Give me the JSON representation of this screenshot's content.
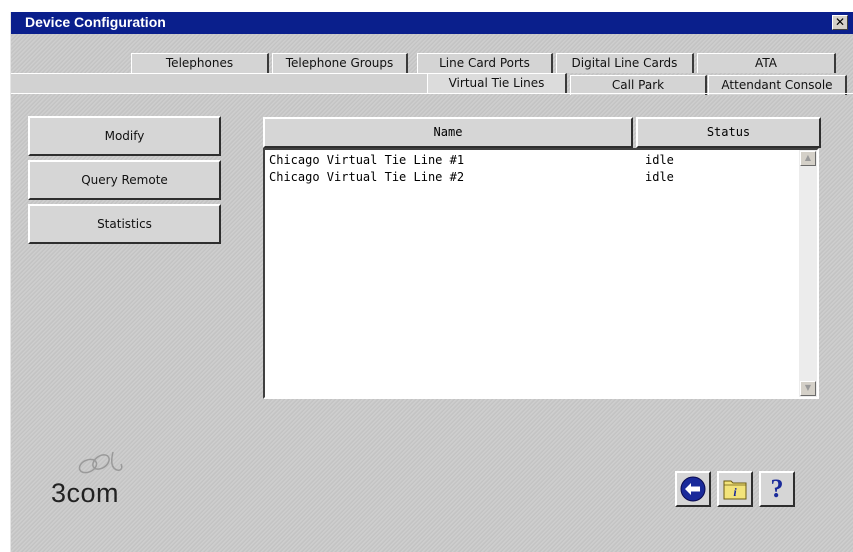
{
  "window": {
    "title": "Device Configuration",
    "close_glyph": "✕"
  },
  "tabs": {
    "row1": [
      {
        "label": "Telephones"
      },
      {
        "label": "Telephone Groups"
      },
      {
        "label": "Line Card Ports"
      },
      {
        "label": "Digital Line Cards"
      },
      {
        "label": "ATA"
      }
    ],
    "row2": [
      {
        "label": "Virtual Tie Lines",
        "active": true
      },
      {
        "label": "Call Park"
      },
      {
        "label": "Attendant Console"
      }
    ]
  },
  "actions": {
    "modify": "Modify",
    "query_remote": "Query Remote",
    "statistics": "Statistics"
  },
  "table": {
    "columns": [
      "Name",
      "Status"
    ],
    "rows": [
      {
        "name": "Chicago Virtual Tie Line #1",
        "status": "idle"
      },
      {
        "name": "Chicago Virtual Tie Line #2",
        "status": "idle"
      }
    ]
  },
  "logo": {
    "text": "3com"
  },
  "toolbar": {
    "back_icon": "back-arrow-icon",
    "info_icon": "info-folder-icon",
    "help_label": "?"
  },
  "colors": {
    "titlebar": "#0a1f8c",
    "window_bg": "#c9c9c9",
    "help_blue": "#1a2a9a"
  }
}
